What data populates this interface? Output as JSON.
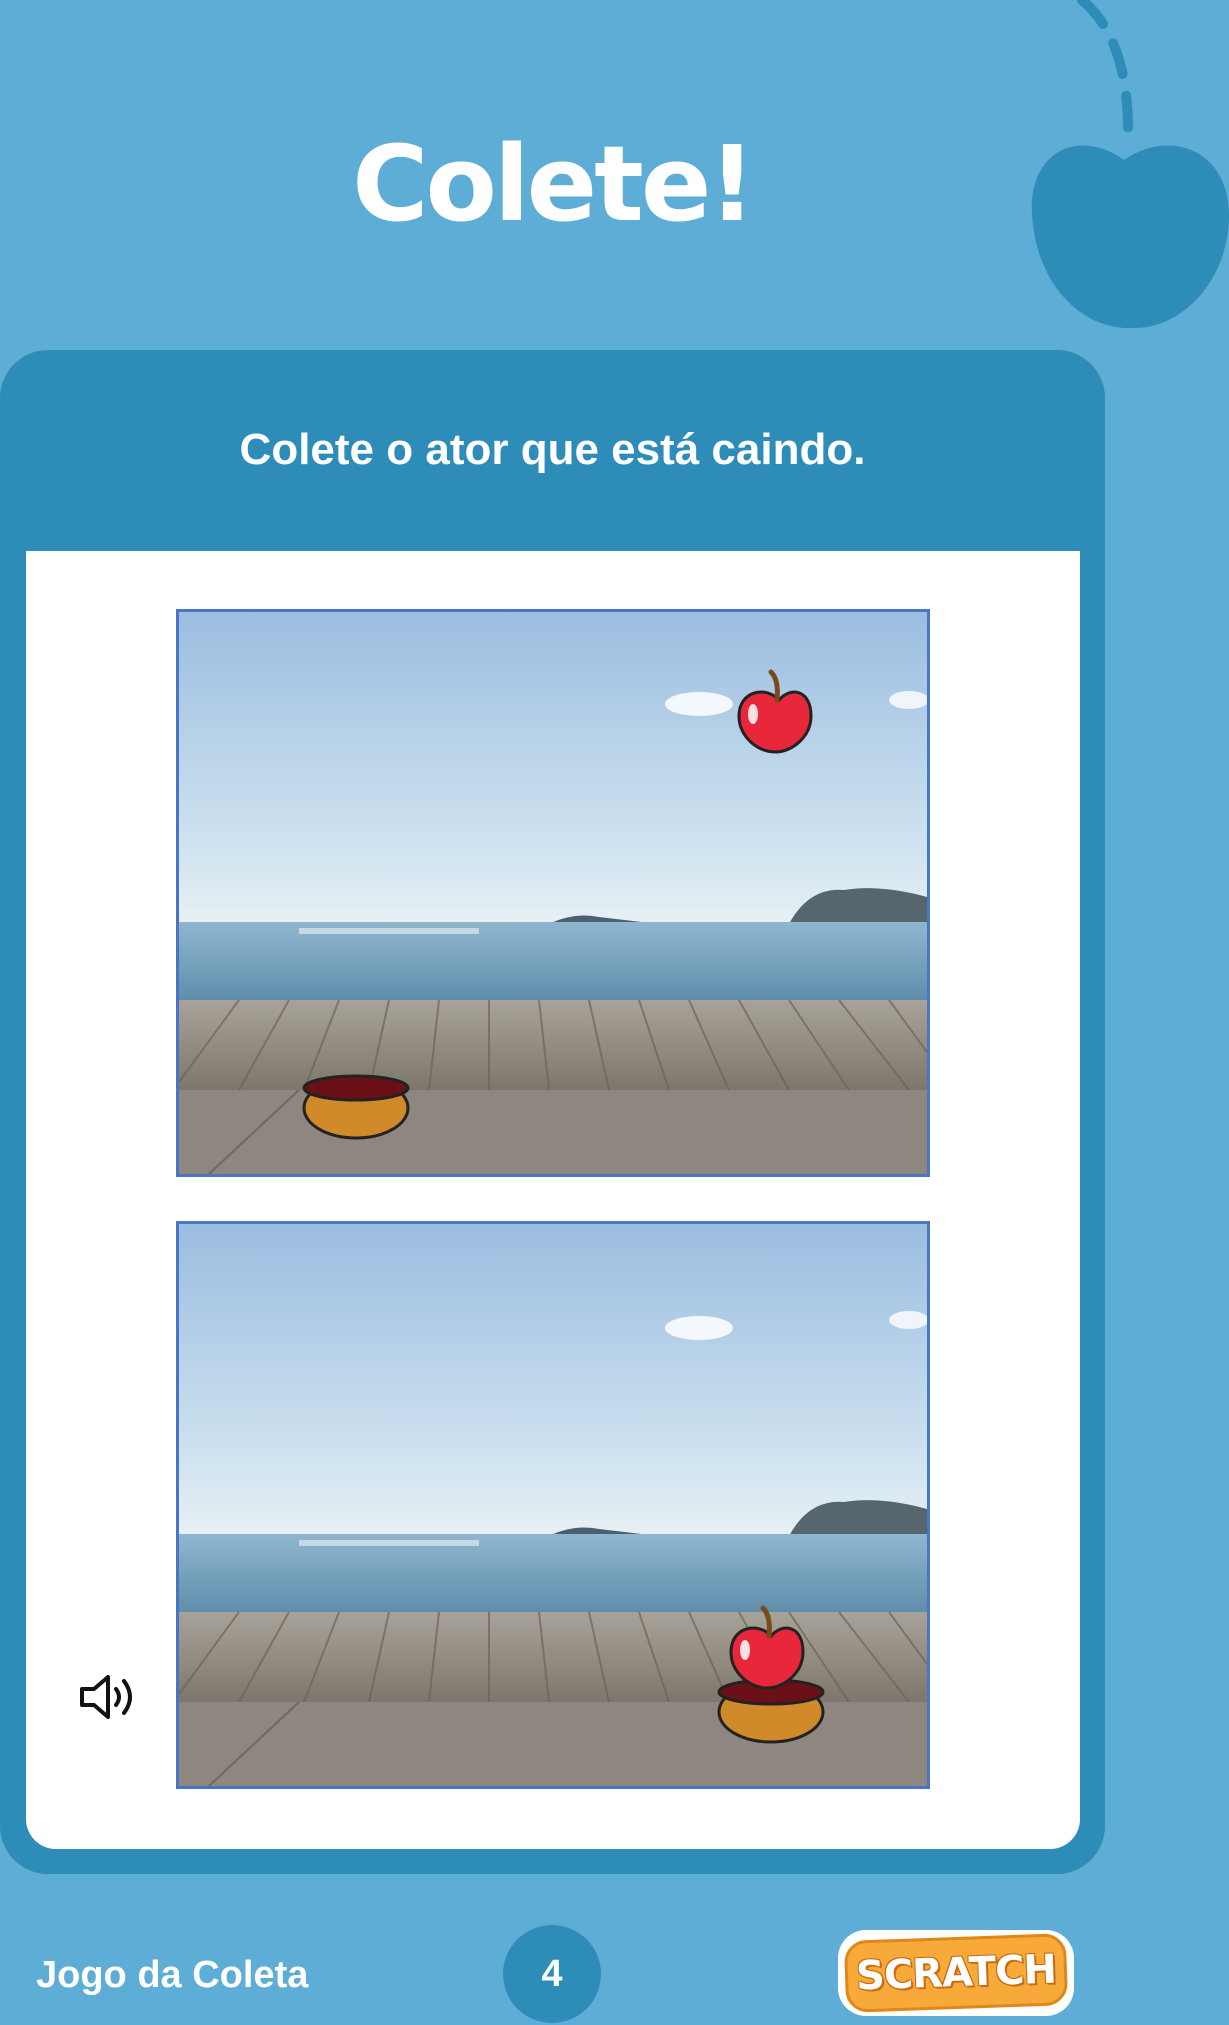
{
  "page": {
    "title": "Colete!",
    "subtitle": "Colete o ator que está caindo.",
    "footer_title": "Jogo da Coleta",
    "page_number": "4",
    "logo_text": "SCRATCH"
  },
  "stages": [
    {
      "name": "stage-before",
      "scene": "beach boardwalk, apple falling from sky, bowl on boardwalk"
    },
    {
      "name": "stage-after",
      "scene": "beach boardwalk, apple landing in bowl"
    }
  ],
  "icons": {
    "apple_decoration": "apple-icon",
    "speaker": "speaker-icon"
  },
  "colors": {
    "background": "#5eadd6",
    "card": "#2e8cb8",
    "card_body": "#ffffff",
    "apple_red": "#e8283a",
    "bowl_orange": "#d08a2a",
    "logo_orange": "#f7a93a"
  }
}
